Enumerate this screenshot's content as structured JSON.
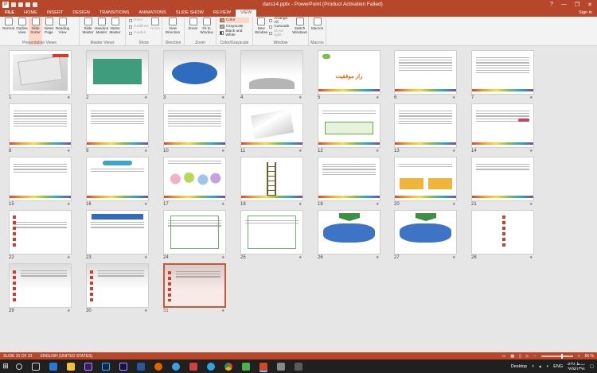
{
  "window": {
    "title": "dars14.pptx - PowerPoint (Product Activation Failed)",
    "controls": [
      "?",
      "—",
      "❐",
      "✕"
    ]
  },
  "tabs": [
    "FILE",
    "HOME",
    "INSERT",
    "DESIGN",
    "TRANSITIONS",
    "ANIMATIONS",
    "SLIDE SHOW",
    "REVIEW",
    "VIEW"
  ],
  "active_tab": "VIEW",
  "signin": "Sign in",
  "ribbon": {
    "presentation_views": {
      "label": "Presentation Views",
      "buttons": [
        "Normal",
        "Outline View",
        "Slide Sorter",
        "Notes Page",
        "Reading View"
      ]
    },
    "master_views": {
      "label": "Master Views",
      "buttons": [
        "Slide Master",
        "Handout Master",
        "Notes Master"
      ]
    },
    "show": {
      "label": "Show",
      "items": [
        "Ruler",
        "Gridlines",
        "Guides"
      ],
      "notes": "Notes"
    },
    "direction": {
      "label": "Direction",
      "button": "View Direction"
    },
    "zoom": {
      "label": "Zoom",
      "buttons": [
        "Zoom",
        "Fit to Window"
      ]
    },
    "color_grayscale": {
      "label": "Color/Grayscale",
      "items": [
        "Color",
        "Grayscale",
        "Black and White"
      ]
    },
    "window": {
      "label": "Window",
      "new_window": "New Window",
      "items": [
        "Arrange All",
        "Cascade",
        "Move Split"
      ],
      "switch": "Switch Windows"
    },
    "macros": {
      "label": "Macros",
      "button": "Macros"
    }
  },
  "slides": [
    {
      "n": "1"
    },
    {
      "n": "2"
    },
    {
      "n": "3"
    },
    {
      "n": "4"
    },
    {
      "n": "5"
    },
    {
      "n": "6"
    },
    {
      "n": "7"
    },
    {
      "n": "8"
    },
    {
      "n": "9"
    },
    {
      "n": "10"
    },
    {
      "n": "11"
    },
    {
      "n": "12"
    },
    {
      "n": "13"
    },
    {
      "n": "14"
    },
    {
      "n": "15"
    },
    {
      "n": "16"
    },
    {
      "n": "17"
    },
    {
      "n": "18"
    },
    {
      "n": "19"
    },
    {
      "n": "20"
    },
    {
      "n": "21"
    },
    {
      "n": "22"
    },
    {
      "n": "23"
    },
    {
      "n": "24"
    },
    {
      "n": "25"
    },
    {
      "n": "26"
    },
    {
      "n": "27"
    },
    {
      "n": "28"
    },
    {
      "n": "29"
    },
    {
      "n": "30"
    },
    {
      "n": "31"
    }
  ],
  "selected_slide": "31",
  "slide5_title": "راز موفقیت",
  "status": {
    "slide": "SLIDE 31 OF 31",
    "language": "ENGLISH (UNITED STATES)",
    "zoom": "66 %"
  },
  "taskbar": {
    "desktop": "Desktop",
    "lang": "ENG",
    "time": "۵:۴۸ ب.ظ",
    "date": "۹۷/۵/۱۳۹۸"
  },
  "colors": {
    "accent": "#b7472a",
    "selected_border": "#c55a3a"
  }
}
